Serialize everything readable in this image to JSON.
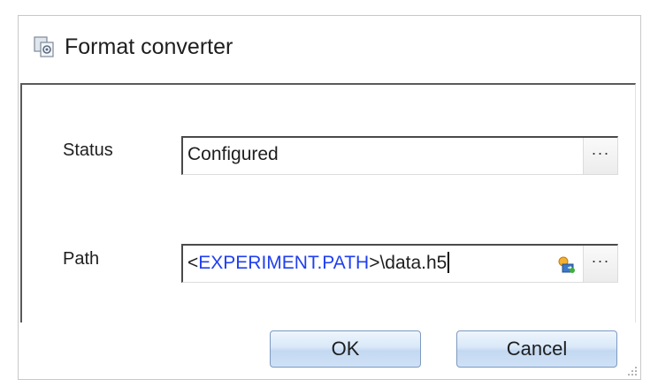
{
  "dialog": {
    "title": "Format converter",
    "title_icon": "converter-icon"
  },
  "fields": {
    "status": {
      "label": "Status",
      "value": "Configured",
      "browse_label": "···"
    },
    "path": {
      "label": "Path",
      "value_prefix": "<",
      "value_variable": "EXPERIMENT.PATH",
      "value_suffix": ">\\data.h5",
      "variable_icon": "insert-variable-icon",
      "browse_label": "···"
    }
  },
  "buttons": {
    "ok_label": "OK",
    "cancel_label": "Cancel"
  },
  "colors": {
    "variable_text": "#1f3ff0",
    "button_border": "#7d9ac2"
  }
}
